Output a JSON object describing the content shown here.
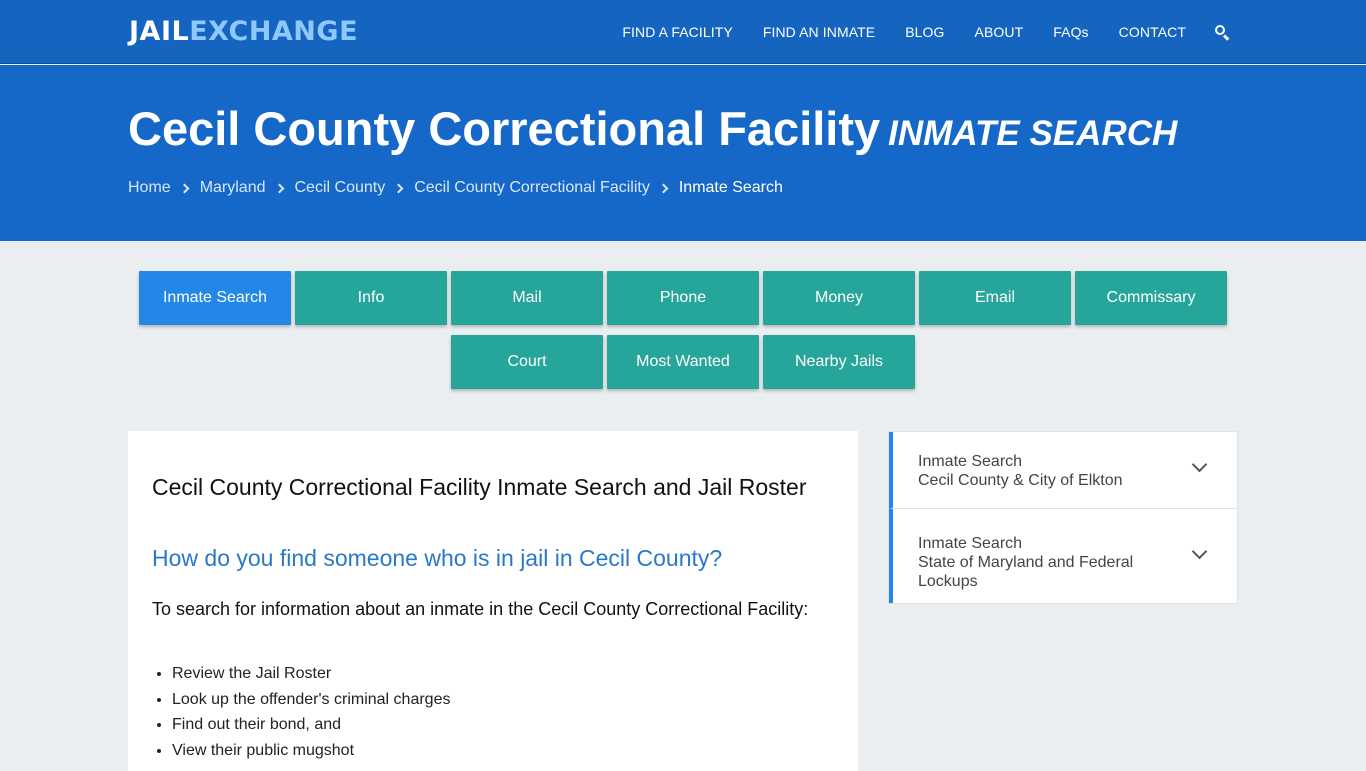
{
  "logo": {
    "part1": "JAIL",
    "part2": "EXCHANGE"
  },
  "nav": {
    "items": [
      "FIND A FACILITY",
      "FIND AN INMATE",
      "BLOG",
      "ABOUT",
      "FAQs",
      "CONTACT"
    ],
    "search_icon": "search-icon"
  },
  "hero": {
    "title": "Cecil County Correctional Facility",
    "subtitle": "INMATE SEARCH",
    "breadcrumbs": [
      "Home",
      "Maryland",
      "Cecil County",
      "Cecil County Correctional Facility"
    ],
    "current": "Inmate Search"
  },
  "tabs": [
    "Inmate Search",
    "Info",
    "Mail",
    "Phone",
    "Money",
    "Email",
    "Commissary",
    "Court",
    "Most Wanted",
    "Nearby Jails"
  ],
  "content": {
    "heading": "Cecil County Correctional Facility Inmate Search and Jail Roster",
    "question": "How do you find someone who is in jail in Cecil County?",
    "intro": "To search for information about an inmate in the Cecil County Correctional Facility:",
    "list": [
      "Review the Jail Roster",
      "Look up the offender's criminal charges",
      "Find out their bond, and",
      "View their public mugshot"
    ]
  },
  "sidebar": {
    "items": [
      {
        "label": "Inmate Search",
        "sub": "Cecil County & City of Elkton"
      },
      {
        "label": "Inmate Search",
        "sub": "State of Maryland and Federal Lockups"
      }
    ]
  },
  "colors": {
    "navbar": "#1565c0",
    "hero": "#1668c8",
    "tab": "#26a69a",
    "tab_active": "#2287e6",
    "question": "#2a78c8"
  }
}
